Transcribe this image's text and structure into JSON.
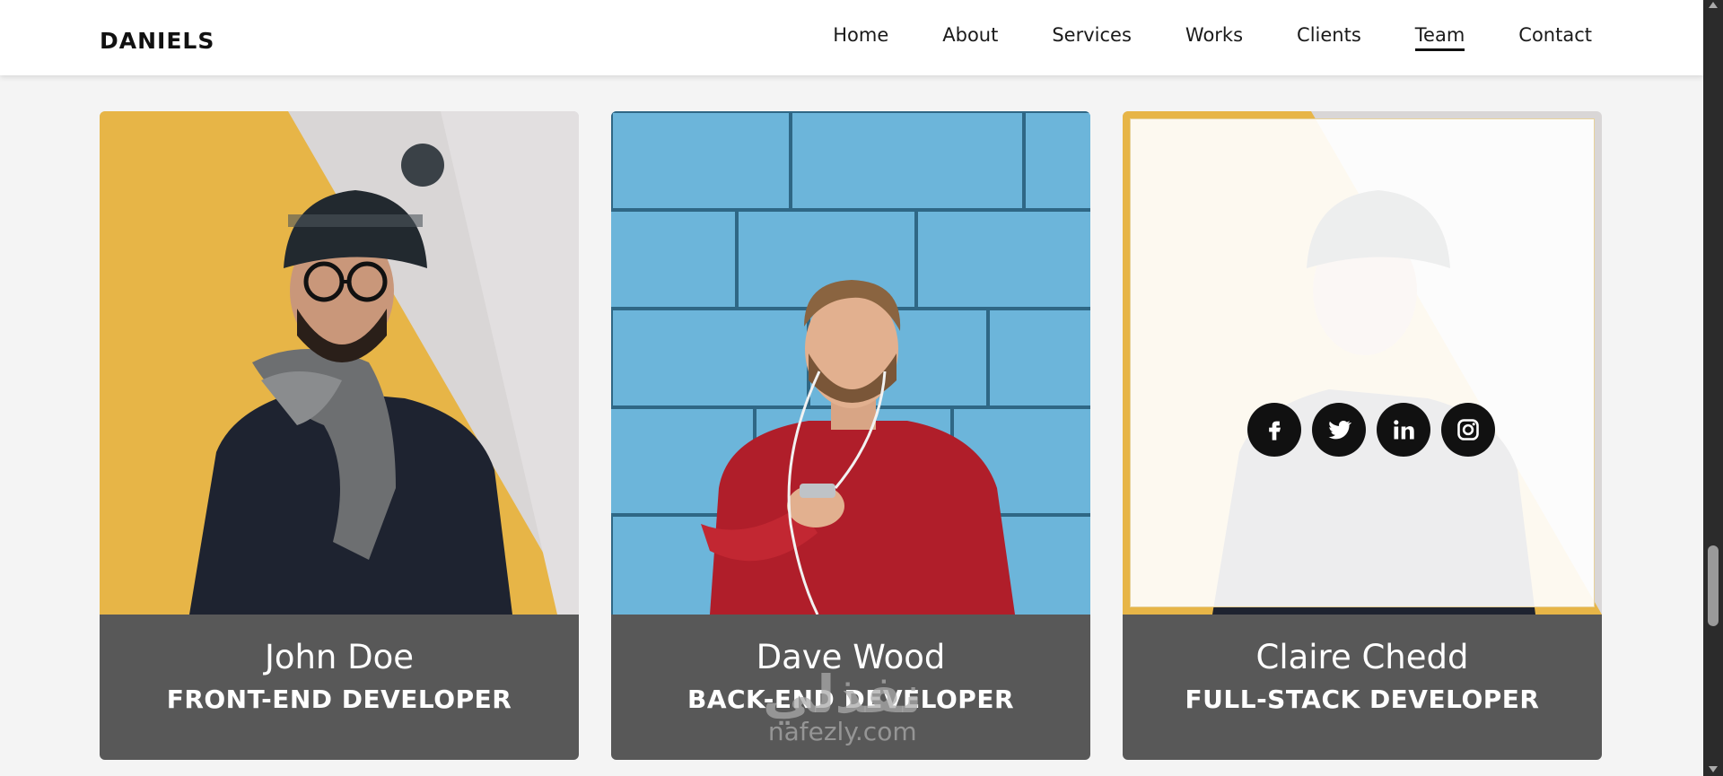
{
  "header": {
    "logo": "DANIELS",
    "nav": [
      {
        "label": "Home",
        "active": false
      },
      {
        "label": "About",
        "active": false
      },
      {
        "label": "Services",
        "active": false
      },
      {
        "label": "Works",
        "active": false
      },
      {
        "label": "Clients",
        "active": false
      },
      {
        "label": "Team",
        "active": true
      },
      {
        "label": "Contact",
        "active": false
      }
    ]
  },
  "team": [
    {
      "name": "John Doe",
      "role": "FRONT-END DEVELOPER"
    },
    {
      "name": "Dave Wood",
      "role": "BACK-END DEVELOPER"
    },
    {
      "name": "Claire Chedd",
      "role": "FULL-STACK DEVELOPER"
    }
  ],
  "social_icons": [
    "facebook-icon",
    "twitter-icon",
    "linkedin-icon",
    "instagram-icon"
  ],
  "watermark": {
    "arabic": "نفذلي",
    "latin": "nafezly.com"
  },
  "colors": {
    "info_panel": "#585858",
    "accent_yellow": "#e7b547",
    "wall_blue": "#63aacf"
  }
}
